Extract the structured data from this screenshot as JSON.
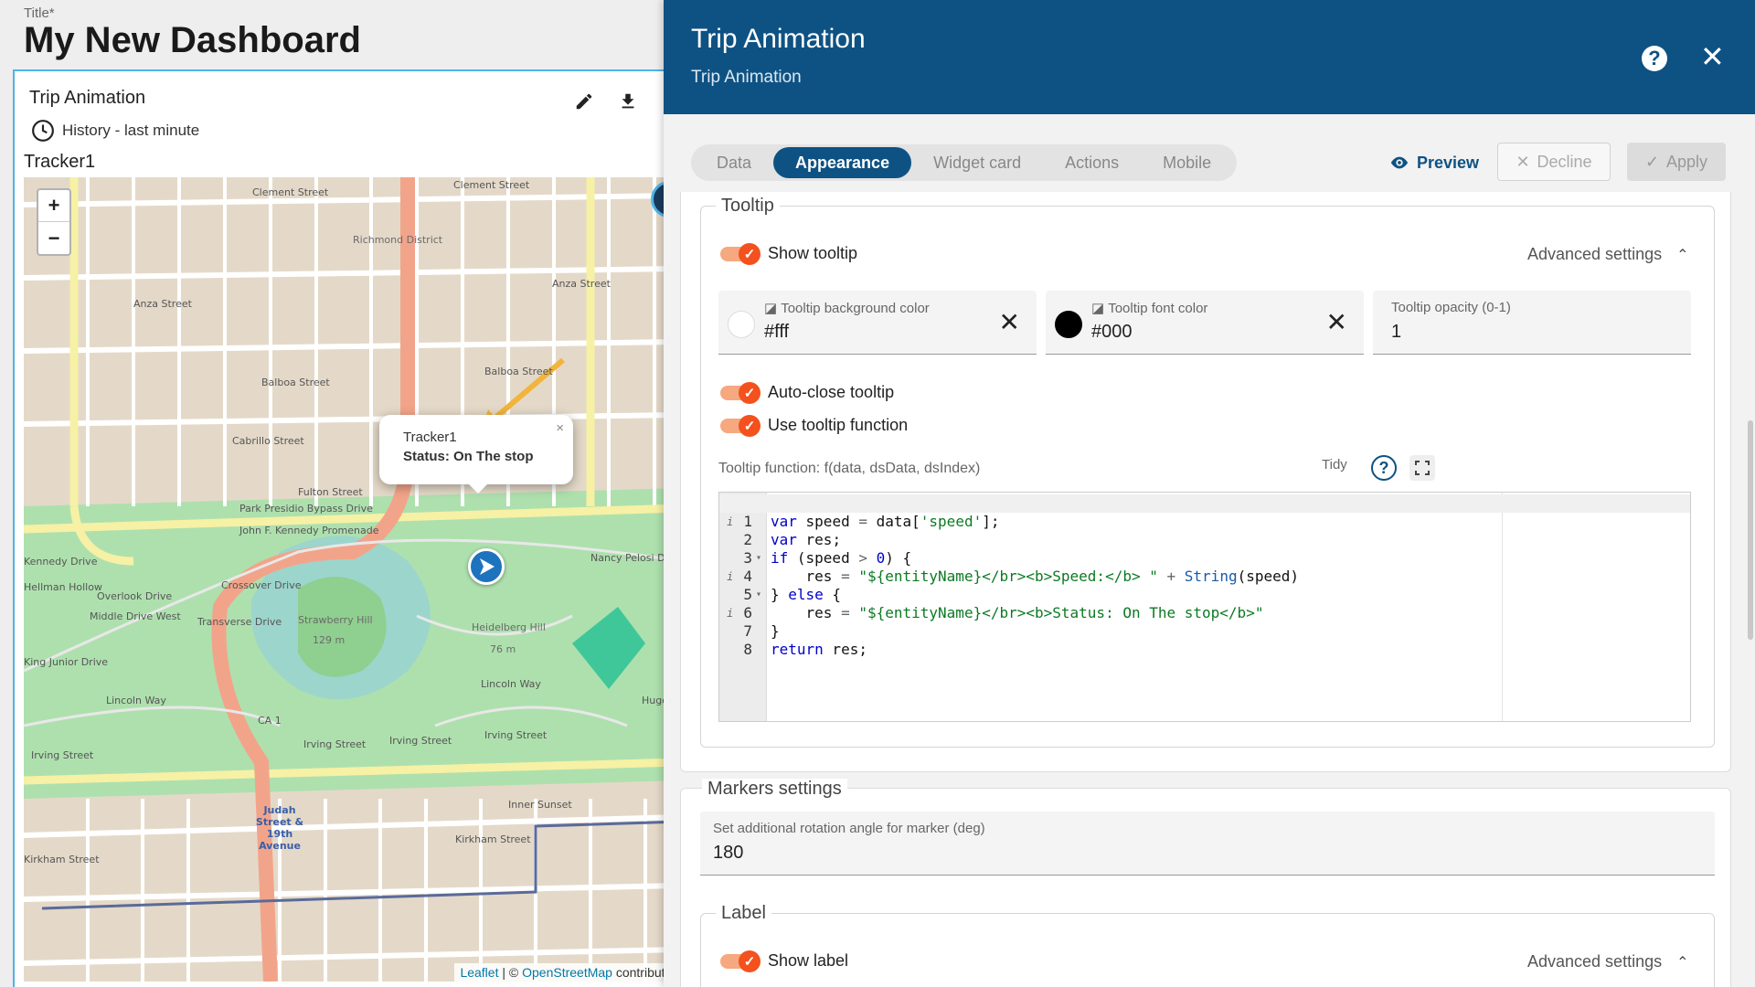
{
  "dashboard": {
    "title_label": "Title*",
    "title": "My New Dashboard"
  },
  "widget": {
    "title": "Trip Animation",
    "history": "History - last minute",
    "tracker_name": "Tracker1",
    "tools": [
      "edit-icon",
      "download-icon",
      "close-icon"
    ],
    "accent_color": "#4fb3e8"
  },
  "map": {
    "zoom_in": "+",
    "zoom_out": "−",
    "popup": {
      "name": "Tracker1",
      "status": "Status: On The stop",
      "close": "×"
    },
    "attribution": {
      "leaflet": "Leaflet",
      "separator": " | © ",
      "osm": "OpenStreetMap",
      "suffix": " contributor"
    },
    "streets": [
      "Clement Street",
      "Clement Street",
      "Anza Street",
      "Anza Street",
      "Balboa Street",
      "Balboa Street",
      "Cabrillo Street",
      "Fulton Street",
      "Park Presidio Bypass Drive",
      "John F. Kennedy Promenade",
      "Kennedy Drive",
      "Overlook Drive",
      "Middle Drive West",
      "King Junior Drive",
      "Crossover Drive",
      "Transverse Drive",
      "Lincoln Way",
      "Lincoln Way",
      "Irving Street",
      "Irving Street",
      "Irving Street",
      "Irving Street",
      "Kirkham Street",
      "Kirkham Street",
      "Inner Sunset",
      "Nancy Pelosi Drive",
      "Hugo Street",
      "Richmond District",
      "Strawberry Hill",
      "129 m",
      "Heidelberg Hill",
      "76 m",
      "Judah Street & 19th Avenue",
      "CA 1",
      "Hellman Hollow"
    ],
    "colors": {
      "park": "#aee0ae",
      "road_major": "#f2a48a",
      "road_secondary": "#f6f1a5",
      "block": "#e4d9c8"
    }
  },
  "panel": {
    "title": "Trip Animation",
    "subtitle": "Trip Animation",
    "header_color": "#0e5283",
    "tabs": [
      {
        "label": "Data",
        "active": false
      },
      {
        "label": "Appearance",
        "active": true
      },
      {
        "label": "Widget card",
        "active": false
      },
      {
        "label": "Actions",
        "active": false
      },
      {
        "label": "Mobile",
        "active": false
      }
    ],
    "preview_label": "Preview",
    "decline_label": "Decline",
    "apply_label": "Apply"
  },
  "tooltip": {
    "legend": "Tooltip",
    "show_tooltip": "Show tooltip",
    "show_tooltip_on": true,
    "advanced": "Advanced settings",
    "bg_color_label": "Tooltip background color",
    "bg_color_value": "#fff",
    "font_color_label": "Tooltip font color",
    "font_color_value": "#000",
    "opacity_label": "Tooltip opacity (0-1)",
    "opacity_value": "1",
    "auto_close": "Auto-close tooltip",
    "auto_close_on": true,
    "use_function": "Use tooltip function",
    "use_function_on": true,
    "function_label": "Tooltip function: f(data, dsData, dsIndex)",
    "tidy": "Tidy",
    "toggle_color": "#f4511e"
  },
  "code": {
    "lines": [
      "1",
      "2",
      "3",
      "4",
      "5",
      "6",
      "7",
      "8"
    ]
  },
  "markers": {
    "legend": "Markers settings",
    "rotation_label": "Set additional rotation angle for marker (deg)",
    "rotation_value": "180"
  },
  "label": {
    "legend": "Label",
    "show_label": "Show label",
    "show_label_on": true,
    "advanced": "Advanced settings"
  }
}
